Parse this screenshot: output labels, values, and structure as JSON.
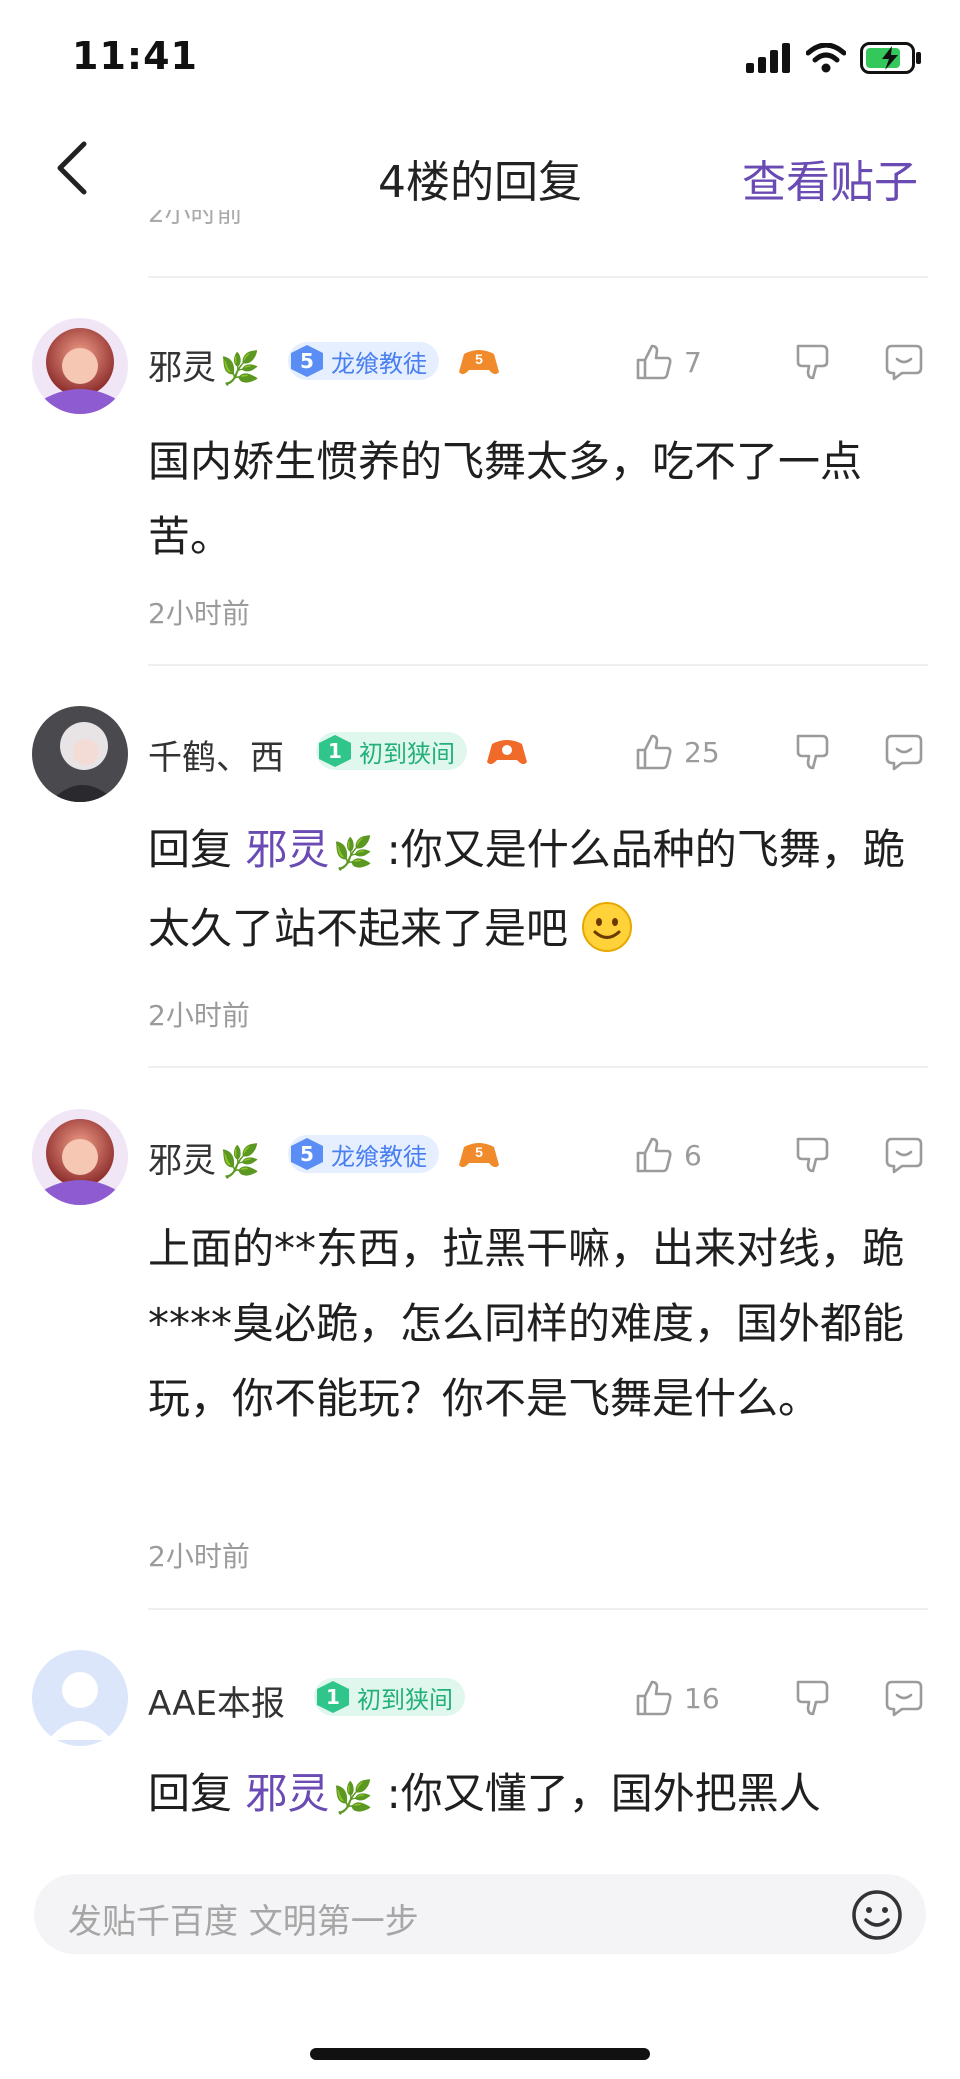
{
  "status": {
    "time": "11:41"
  },
  "nav": {
    "title": "4楼的回复",
    "view_post": "查看贴子"
  },
  "cut_time": "2小时前",
  "comments": [
    {
      "user": "邪灵",
      "badge_level": "5",
      "badge_text": "龙飨教徒",
      "likes": "7",
      "text": "国内娇生惯养的飞舞太多，吃不了一点苦。",
      "time": "2小时前"
    },
    {
      "user": "千鹤、西",
      "badge_level": "1",
      "badge_text": "初到狭间",
      "likes": "25",
      "reply_prefix": "回复",
      "reply_to": "邪灵",
      "text": ":你又是什么品种的飞舞，跪太久了站不起来了是吧",
      "time": "2小时前"
    },
    {
      "user": "邪灵",
      "badge_level": "5",
      "badge_text": "龙飨教徒",
      "likes": "6",
      "text": "上面的**东西，拉黑干嘛，出来对线，跪****臭必跪，怎么同样的难度，国外都能玩，你不能玩？你不是飞舞是什么。",
      "time": "2小时前"
    },
    {
      "user": "AAE本报",
      "badge_level": "1",
      "badge_text": "初到狭间",
      "likes": "16",
      "reply_prefix": "回复",
      "reply_to": "邪灵",
      "text": ":你又懂了，国外把黑人"
    }
  ],
  "input": {
    "placeholder": "发贴千百度 文明第一步"
  },
  "icons": [
    "back-icon",
    "thumb-up-icon",
    "thumb-down-icon",
    "reply-icon",
    "smile-icon",
    "leaf-icon",
    "gamepad-icon",
    "signal-icon",
    "wifi-icon",
    "battery-icon"
  ],
  "colors": {
    "accent": "#6a4bb3",
    "blue_badge": "#5a8ef5",
    "green_badge": "#30c58a"
  }
}
